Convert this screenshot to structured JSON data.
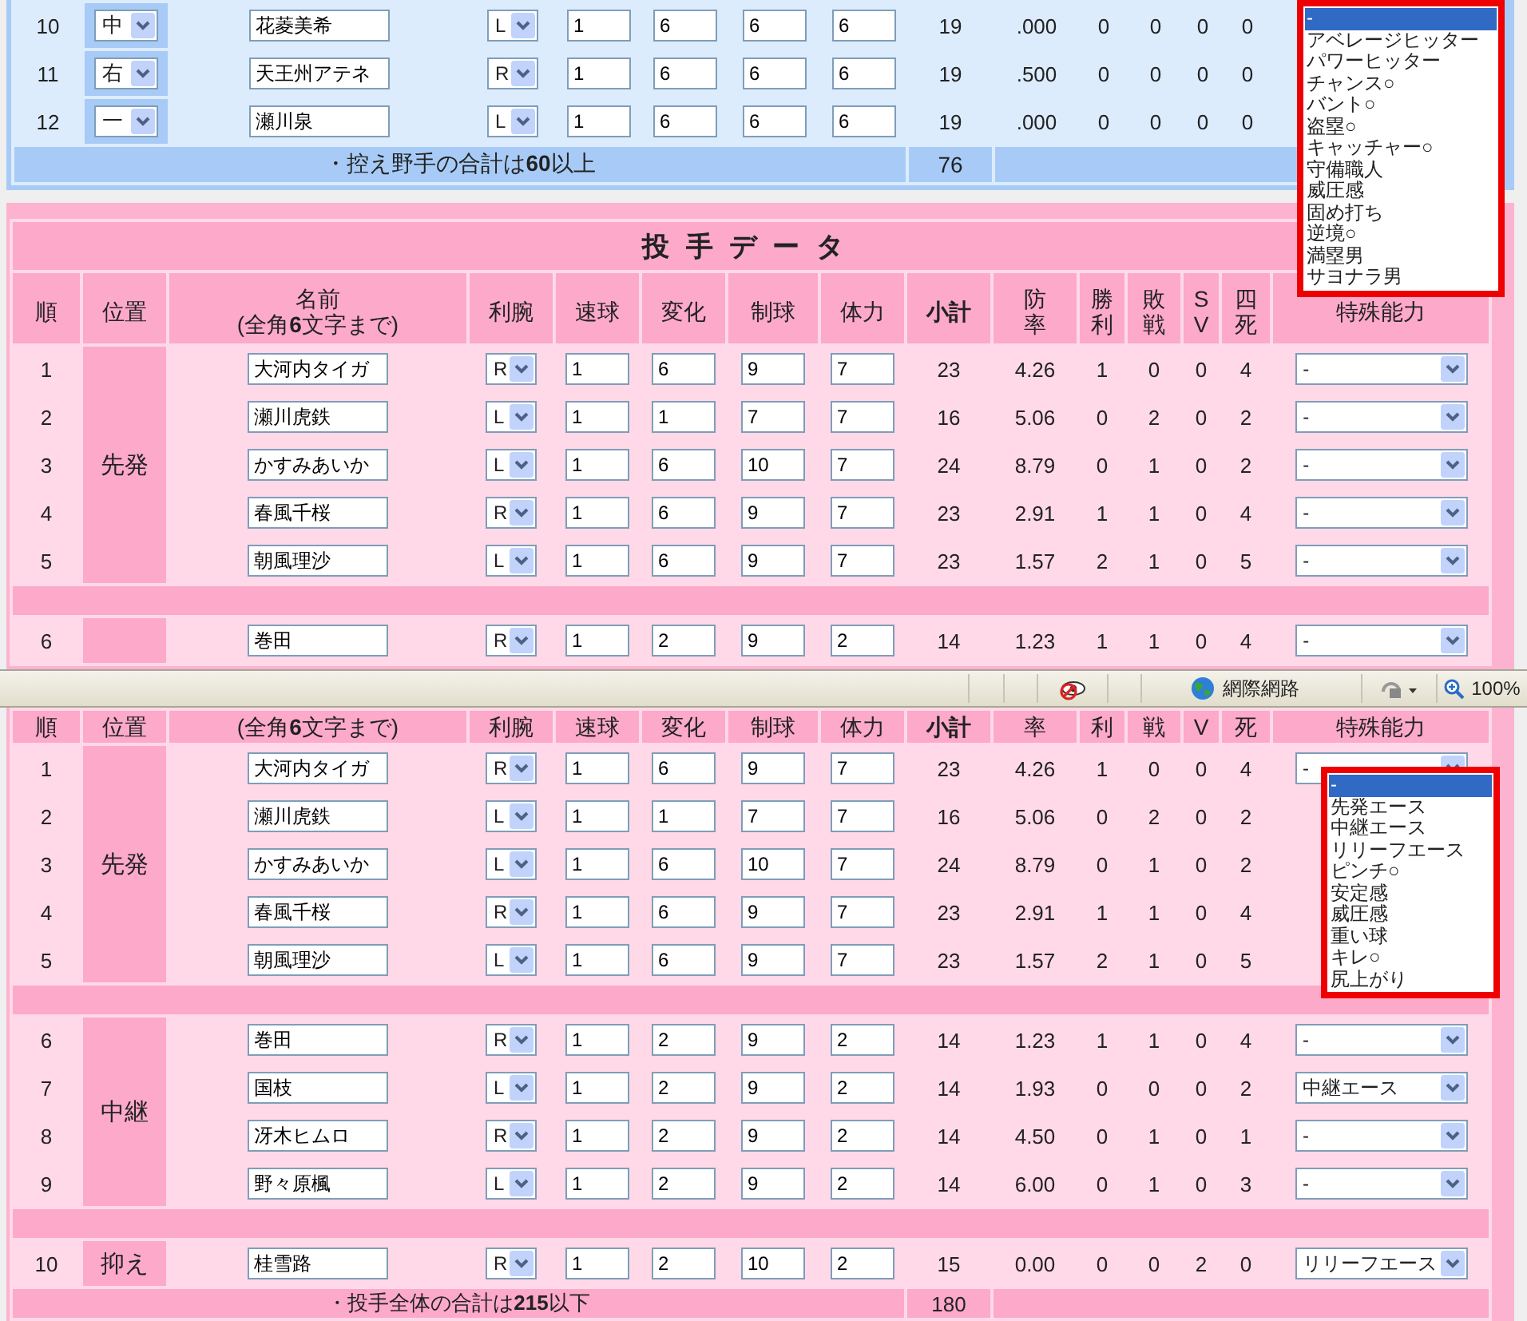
{
  "fielders": {
    "rows": [
      {
        "no": "10",
        "position": "中",
        "name": "花菱美希",
        "hand": "L",
        "inputs": [
          "1",
          "6",
          "6",
          "6"
        ],
        "stats": [
          "19",
          ".000",
          "0",
          "0",
          "0",
          "0"
        ]
      },
      {
        "no": "11",
        "position": "右",
        "name": "天王州アテネ",
        "hand": "R",
        "inputs": [
          "1",
          "6",
          "6",
          "6"
        ],
        "stats": [
          "19",
          ".500",
          "0",
          "0",
          "0",
          "0"
        ]
      },
      {
        "no": "12",
        "position": "一",
        "name": "瀬川泉",
        "hand": "L",
        "inputs": [
          "1",
          "6",
          "6",
          "6"
        ],
        "stats": [
          "19",
          ".000",
          "0",
          "0",
          "0",
          "0"
        ]
      }
    ],
    "total": {
      "label": "・控え野手の合計は**60**以上",
      "value": "76"
    }
  },
  "batter_ability_list": {
    "options": [
      {
        "label": "-",
        "selected": true
      },
      {
        "label": "アベレージヒッター",
        "selected": false
      },
      {
        "label": "パワーヒッター",
        "selected": false
      },
      {
        "label": "チャンス○",
        "selected": false
      },
      {
        "label": "バント○",
        "selected": false
      },
      {
        "label": "盗塁○",
        "selected": false
      },
      {
        "label": "キャッチャー○",
        "selected": false
      },
      {
        "label": "守備職人",
        "selected": false
      },
      {
        "label": "威圧感",
        "selected": false
      },
      {
        "label": "固め打ち",
        "selected": false
      },
      {
        "label": "逆境○",
        "selected": false
      },
      {
        "label": "満塁男",
        "selected": false
      },
      {
        "label": "サヨナラ男",
        "selected": false
      }
    ]
  },
  "pitchers_top": {
    "title": "投手データ",
    "columns": [
      {
        "label": "順",
        "kind": "plain"
      },
      {
        "label": "位置",
        "kind": "plain"
      },
      {
        "label": "名前",
        "note": "(全角**6**文字まで)",
        "kind": "plain"
      },
      {
        "label": "利腕",
        "kind": "plain"
      },
      {
        "label": "速球",
        "kind": "plain"
      },
      {
        "label": "変化",
        "kind": "plain"
      },
      {
        "label": "制球",
        "kind": "plain"
      },
      {
        "label": "体力",
        "kind": "plain"
      },
      {
        "label": "小計",
        "kind": "bold"
      },
      {
        "label": "防率",
        "kind": "stacked"
      },
      {
        "label": "勝利",
        "kind": "stacked"
      },
      {
        "label": "敗戦",
        "kind": "stacked"
      },
      {
        "label": "SV",
        "kind": "stacked"
      },
      {
        "label": "四死",
        "kind": "stacked"
      },
      {
        "label": "特殊能力",
        "kind": "plain"
      }
    ],
    "groups": [
      {
        "label": "先発",
        "rows": [
          {
            "no": "1",
            "name": "大河内タイガ",
            "hand": "R",
            "inputs": [
              "1",
              "6",
              "9",
              "7"
            ],
            "stats": [
              "23",
              "4.26",
              "1",
              "0",
              "0",
              "4"
            ],
            "ability": "-"
          },
          {
            "no": "2",
            "name": "瀬川虎鉄",
            "hand": "L",
            "inputs": [
              "1",
              "1",
              "7",
              "7"
            ],
            "stats": [
              "16",
              "5.06",
              "0",
              "2",
              "0",
              "2"
            ],
            "ability": "-"
          },
          {
            "no": "3",
            "name": "かすみあいか",
            "hand": "L",
            "inputs": [
              "1",
              "6",
              "10",
              "7"
            ],
            "stats": [
              "24",
              "8.79",
              "0",
              "1",
              "0",
              "2"
            ],
            "ability": "-"
          },
          {
            "no": "4",
            "name": "春風千桜",
            "hand": "R",
            "inputs": [
              "1",
              "6",
              "9",
              "7"
            ],
            "stats": [
              "23",
              "2.91",
              "1",
              "1",
              "0",
              "4"
            ],
            "ability": "-"
          },
          {
            "no": "5",
            "name": "朝風理沙",
            "hand": "L",
            "inputs": [
              "1",
              "6",
              "9",
              "7"
            ],
            "stats": [
              "23",
              "1.57",
              "2",
              "1",
              "0",
              "5"
            ],
            "ability": "-"
          }
        ]
      },
      {
        "rows": [
          {
            "no": "6",
            "name": "巻田",
            "hand": "R",
            "inputs": [
              "1",
              "2",
              "9",
              "2"
            ],
            "stats": [
              "14",
              "1.23",
              "1",
              "1",
              "0",
              "4"
            ],
            "ability": "-"
          }
        ]
      }
    ]
  },
  "status_bar": {
    "zone": "網際網路",
    "zoom": "100%"
  },
  "pitchers_bottom": {
    "columns": [
      {
        "label": "順",
        "kind": "plain"
      },
      {
        "label": "位置",
        "kind": "plain"
      },
      {
        "note": "(全角**6**文字まで)"
      },
      {
        "label": "利腕",
        "kind": "plain"
      },
      {
        "label": "速球",
        "kind": "plain"
      },
      {
        "label": "変化",
        "kind": "plain"
      },
      {
        "label": "制球",
        "kind": "plain"
      },
      {
        "label": "体力",
        "kind": "plain"
      },
      {
        "label": "小計",
        "kind": "bold"
      },
      {
        "label": "率",
        "kind": "plain"
      },
      {
        "label": "利",
        "kind": "plain"
      },
      {
        "label": "戦",
        "kind": "plain"
      },
      {
        "label": "V",
        "kind": "plain"
      },
      {
        "label": "死",
        "kind": "plain"
      },
      {
        "label": "特殊能力",
        "kind": "plain"
      }
    ],
    "groups": [
      {
        "label": "先発",
        "rows": [
          {
            "no": "1",
            "name": "大河内タイガ",
            "hand": "R",
            "inputs": [
              "1",
              "6",
              "9",
              "7"
            ],
            "stats": [
              "23",
              "4.26",
              "1",
              "0",
              "0",
              "4"
            ],
            "ability": "-"
          },
          {
            "no": "2",
            "name": "瀬川虎鉄",
            "hand": "L",
            "inputs": [
              "1",
              "1",
              "7",
              "7"
            ],
            "stats": [
              "16",
              "5.06",
              "0",
              "2",
              "0",
              "2"
            ]
          },
          {
            "no": "3",
            "name": "かすみあいか",
            "hand": "L",
            "inputs": [
              "1",
              "6",
              "10",
              "7"
            ],
            "stats": [
              "24",
              "8.79",
              "0",
              "1",
              "0",
              "2"
            ]
          },
          {
            "no": "4",
            "name": "春風千桜",
            "hand": "R",
            "inputs": [
              "1",
              "6",
              "9",
              "7"
            ],
            "stats": [
              "23",
              "2.91",
              "1",
              "1",
              "0",
              "4"
            ]
          },
          {
            "no": "5",
            "name": "朝風理沙",
            "hand": "L",
            "inputs": [
              "1",
              "6",
              "9",
              "7"
            ],
            "stats": [
              "23",
              "1.57",
              "2",
              "1",
              "0",
              "5"
            ]
          }
        ]
      },
      {
        "label": "中継",
        "rows": [
          {
            "no": "6",
            "name": "巻田",
            "hand": "R",
            "inputs": [
              "1",
              "2",
              "9",
              "2"
            ],
            "stats": [
              "14",
              "1.23",
              "1",
              "1",
              "0",
              "4"
            ],
            "ability": "-"
          },
          {
            "no": "7",
            "name": "国枝",
            "hand": "L",
            "inputs": [
              "1",
              "2",
              "9",
              "2"
            ],
            "stats": [
              "14",
              "1.93",
              "0",
              "0",
              "0",
              "2"
            ],
            "ability": "中継エース"
          },
          {
            "no": "8",
            "name": "冴木ヒムロ",
            "hand": "R",
            "inputs": [
              "1",
              "2",
              "9",
              "2"
            ],
            "stats": [
              "14",
              "4.50",
              "0",
              "1",
              "0",
              "1"
            ],
            "ability": "-"
          },
          {
            "no": "9",
            "name": "野々原楓",
            "hand": "L",
            "inputs": [
              "1",
              "2",
              "9",
              "2"
            ],
            "stats": [
              "14",
              "6.00",
              "0",
              "1",
              "0",
              "3"
            ],
            "ability": "-"
          }
        ]
      },
      {
        "label": "抑え",
        "rows": [
          {
            "no": "10",
            "name": "桂雪路",
            "hand": "R",
            "inputs": [
              "1",
              "2",
              "10",
              "2"
            ],
            "stats": [
              "15",
              "0.00",
              "0",
              "0",
              "2",
              "0"
            ],
            "ability": "リリーフエース"
          }
        ]
      }
    ],
    "total": {
      "label": "・投手全体の合計は**215**以下",
      "value": "180"
    }
  },
  "pitcher_ability_list": {
    "options": [
      {
        "label": "-",
        "selected": true
      },
      {
        "label": "先発エース",
        "selected": false
      },
      {
        "label": "中継エース",
        "selected": false
      },
      {
        "label": "リリーフエース",
        "selected": false
      },
      {
        "label": "ピンチ○",
        "selected": false
      },
      {
        "label": "安定感",
        "selected": false
      },
      {
        "label": "威圧感",
        "selected": false
      },
      {
        "label": "重い球",
        "selected": false
      },
      {
        "label": "キレ○",
        "selected": false
      },
      {
        "label": "尻上がり",
        "selected": false
      }
    ]
  }
}
